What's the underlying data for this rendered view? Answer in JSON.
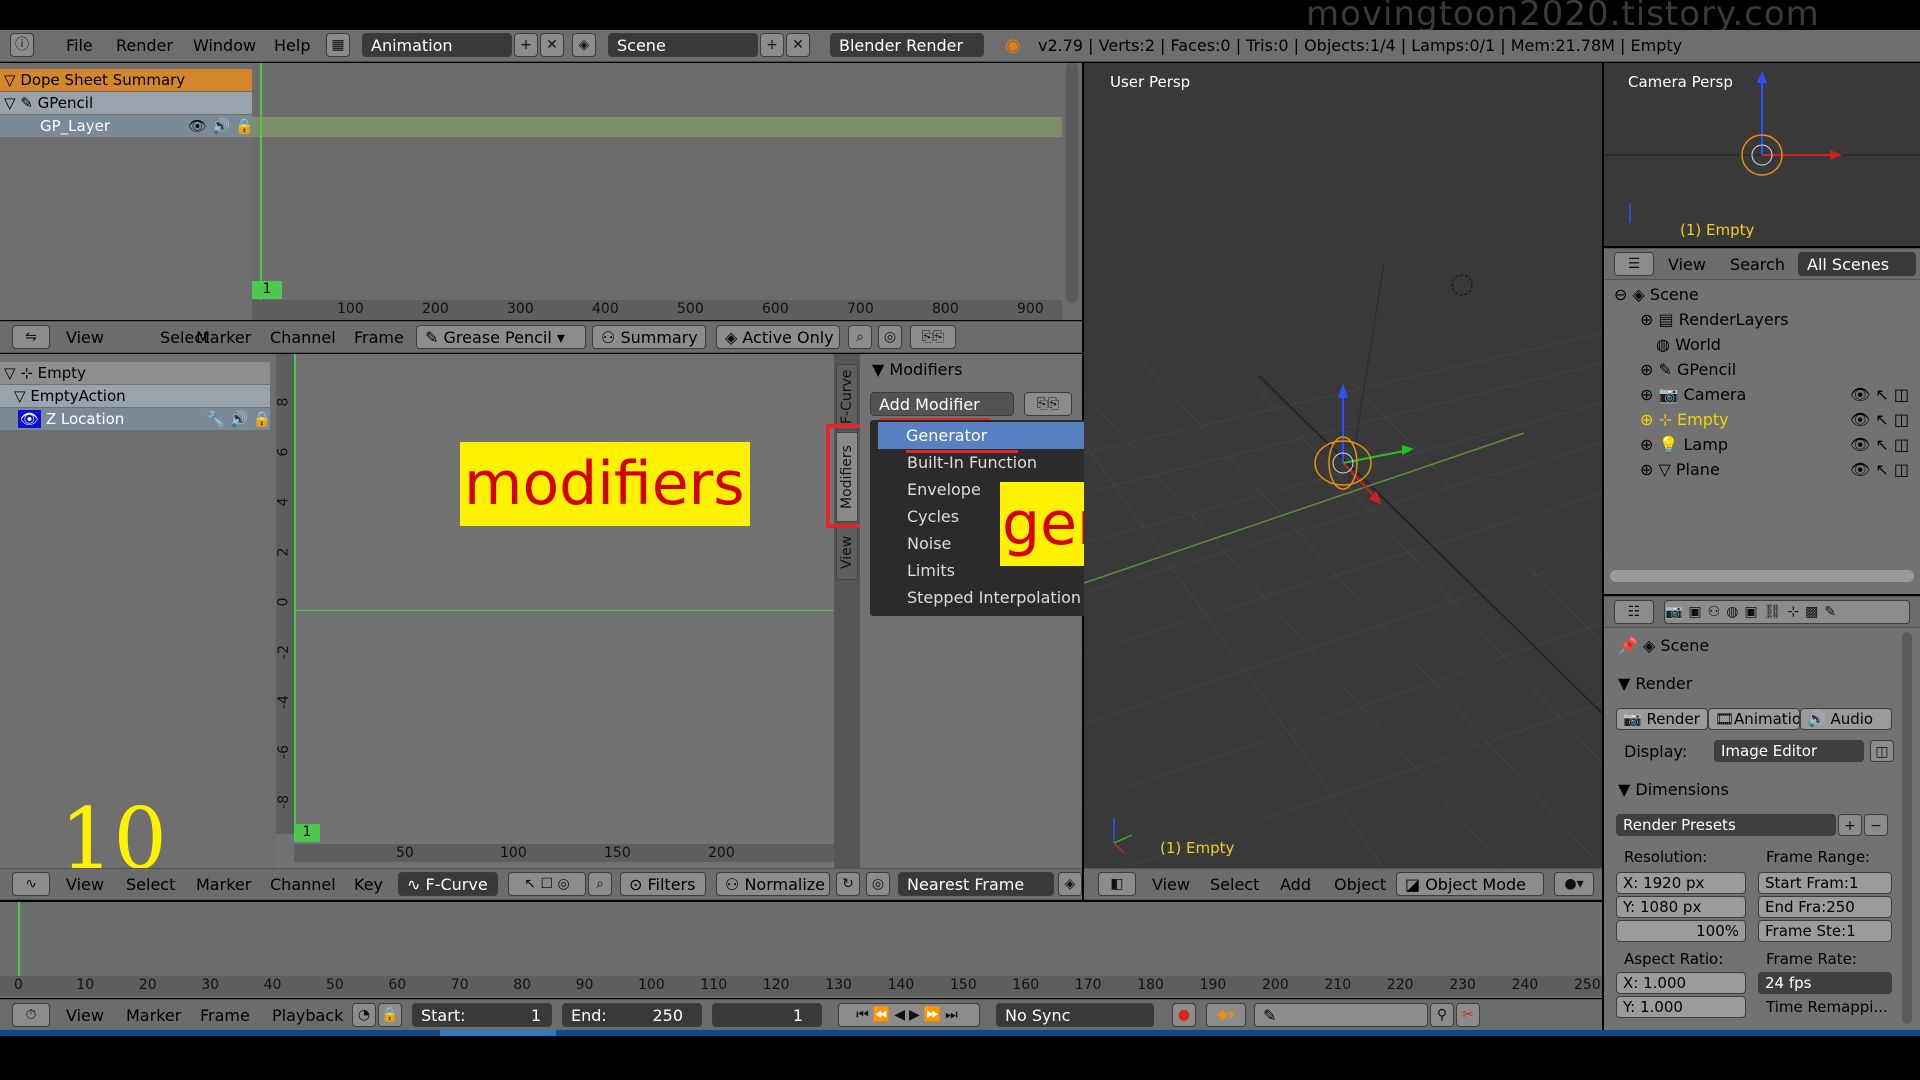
{
  "watermark": "movingtoon2020.tistory.com",
  "info_bar": {
    "menus": [
      "File",
      "Render",
      "Window",
      "Help"
    ],
    "layout": "Animation",
    "scene": "Scene",
    "engine": "Blender Render",
    "stats": "v2.79 | Verts:2 | Faces:0 | Tris:0 | Objects:1/4 | Lamps:0/1 | Mem:21.78M | Empty"
  },
  "dopesheet": {
    "channels": [
      "Dope Sheet Summary",
      "GPencil",
      "GP_Layer"
    ],
    "frame_badge": "1",
    "ruler": [
      "100",
      "200",
      "300",
      "400",
      "500",
      "600",
      "700",
      "800",
      "900"
    ],
    "header": {
      "menus": [
        "View",
        "Select",
        "Marker",
        "Channel",
        "Frame"
      ],
      "mode": "Grease Pencil",
      "summary": "Summary",
      "active_only": "Active Only"
    }
  },
  "graph_editor": {
    "channels": [
      "Empty",
      "EmptyAction",
      "Z Location"
    ],
    "y_ticks": [
      "8",
      "6",
      "4",
      "2",
      "0",
      "-2",
      "-4",
      "-6",
      "-8"
    ],
    "ruler": [
      "50",
      "100",
      "150",
      "200"
    ],
    "frame_badge": "1",
    "tabs": [
      "F-Curve",
      "Modifiers",
      "View"
    ],
    "modifiers_panel_title": "Modifiers",
    "add_modifier": "Add Modifier",
    "dropdown": [
      "Generator",
      "Built-In Function",
      "Envelope",
      "Cycles",
      "Noise",
      "Limits",
      "Stepped Interpolation"
    ],
    "header": {
      "menus": [
        "View",
        "Select",
        "Marker",
        "Channel",
        "Key"
      ],
      "mode": "F-Curve",
      "filters": "Filters",
      "normalize": "Normalize",
      "snap": "Nearest Frame"
    }
  },
  "annotations": {
    "modifiers": "modifiers",
    "generator": "generator",
    "step": "10"
  },
  "viewport": {
    "label": "User Persp",
    "object": "(1) Empty",
    "header": {
      "menus": [
        "View",
        "Select",
        "Add",
        "Object"
      ],
      "mode": "Object Mode"
    }
  },
  "camera_view": {
    "label": "Camera Persp",
    "object": "(1) Empty"
  },
  "outliner": {
    "header": {
      "view": "View",
      "search": "Search",
      "filter": "All Scenes"
    },
    "items": [
      "Scene",
      "RenderLayers",
      "World",
      "GPencil",
      "Camera",
      "Empty",
      "Lamp",
      "Plane"
    ]
  },
  "properties": {
    "context": "Scene",
    "render_panel": "Render",
    "render_buttons": [
      "Render",
      "Animatio",
      "Audio"
    ],
    "display_label": "Display:",
    "display_value": "Image Editor",
    "dimensions_panel": "Dimensions",
    "render_presets": "Render Presets",
    "resolution_label": "Resolution:",
    "res_x": "X:  1920 px",
    "res_y": "Y:  1080 px",
    "res_pct": "100%",
    "frame_range_label": "Frame Range:",
    "start_frame": "Start Fram:1",
    "end_frame": "End Fra:250",
    "frame_step": "Frame Ste:1",
    "aspect_label": "Aspect Ratio:",
    "aspect_x": "X:   1.000",
    "aspect_y": "Y:   1.000",
    "frame_rate_label": "Frame Rate:",
    "frame_rate": "24 fps",
    "time_remap": "Time Remappi..."
  },
  "timeline": {
    "ruler": [
      "0",
      "10",
      "20",
      "30",
      "40",
      "50",
      "60",
      "70",
      "80",
      "90",
      "100",
      "110",
      "120",
      "130",
      "140",
      "150",
      "160",
      "170",
      "180",
      "190",
      "200",
      "210",
      "220",
      "230",
      "240",
      "250"
    ],
    "menus": [
      "View",
      "Marker",
      "Frame",
      "Playback"
    ],
    "start": "Start:",
    "start_val": "1",
    "end": "End:",
    "end_val": "250",
    "current": "1",
    "sync": "No Sync"
  }
}
